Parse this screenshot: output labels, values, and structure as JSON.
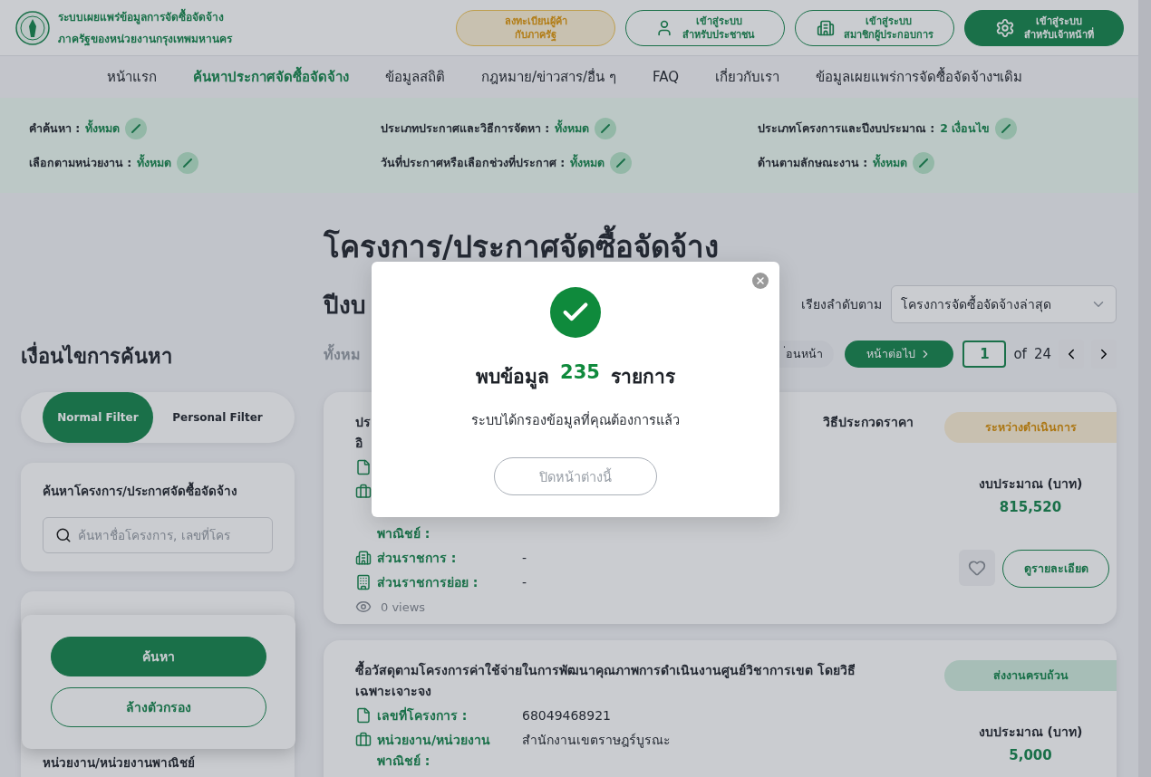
{
  "header": {
    "site_title": [
      "ระบบเผยแพร่ข้อมูลการจัดซื้อจัดจ้าง",
      "ภาครัฐของหน่วยงานกรุงเทพมหานคร"
    ],
    "buttons": [
      {
        "kind": "register",
        "lines": [
          "ลงทะเบียนผู้ค้า",
          "กับภาครัฐ"
        ]
      },
      {
        "kind": "citizen",
        "lines": [
          "เข้าสู่ระบบ",
          "สำหรับประชาชน"
        ]
      },
      {
        "kind": "member",
        "lines": [
          "เข้าสู่ระบบ",
          "สมาชิกผู้ประกอบการ"
        ]
      },
      {
        "kind": "staff",
        "lines": [
          "เข้าสู่ระบบ",
          "สำหรับเจ้าหน้าที่"
        ]
      }
    ]
  },
  "nav": [
    {
      "label": "หน้าแรก",
      "selected": false
    },
    {
      "label": "ค้นหาประกาศจัดซื้อจัดจ้าง",
      "selected": true
    },
    {
      "label": "ข้อมูลสถิติ",
      "selected": false
    },
    {
      "label": "กฎหมาย/ข่าวสาร/อื่น ๆ",
      "selected": false
    },
    {
      "label": "FAQ",
      "selected": false
    },
    {
      "label": "เกี่ยวกับเรา",
      "selected": false
    },
    {
      "label": "ข้อมูลเผยแพร่การจัดซื้อจัดจ้างฯเดิม",
      "selected": false
    }
  ],
  "filter_summary": [
    {
      "label": "คำค้นหา :",
      "value": "ทั้งหมด"
    },
    {
      "label": "ประเภทประกาศและวิธีการจัดหา :",
      "value": "ทั้งหมด"
    },
    {
      "label": "ประเภทโครงการและปีงบประมาณ :",
      "value": "2 เงื่อนไข"
    },
    {
      "label": "เลือกตามหน่วยงาน :",
      "value": "ทั้งหมด"
    },
    {
      "label": "วันที่ประกาศหรือเลือกช่วงที่ประกาศ :",
      "value": "ทั้งหมด"
    },
    {
      "label": "ด้านตามลักษณะงาน :",
      "value": "ทั้งหมด"
    }
  ],
  "sidebar": {
    "title": "เงื่อนไขการค้นหา",
    "filter_modes": [
      {
        "label": "Normal Filter",
        "selected": true
      },
      {
        "label": "Personal Filter",
        "selected": false
      }
    ],
    "search_card": {
      "title": "ค้นหาโครงการ/ประกาศจัดซื้อจัดจ้าง",
      "placeholder": "ค้นหาชื่อโครงการ, เลขที่โคร"
    },
    "unit_card_title": "หน่วยงาน/หน่วยงานพาณิชย์",
    "actions": [
      {
        "kind": "primary",
        "label": "ค้นหา"
      },
      {
        "kind": "outline",
        "label": "ล้างตัวกรอง"
      }
    ]
  },
  "main": {
    "title": "โครงการ/ประกาศจัดซื้อจัดจ้าง",
    "year_heading": "ปีงบ",
    "count_text": "ทั้งหม",
    "sort_label": "เรียงลำดับตาม",
    "sort_value": "โครงการจัดซื้อจัดจ้างล่าสุด",
    "pagination": {
      "prev": "่อนหน้า",
      "next": "หน้าต่อไป",
      "page": "1",
      "of": "of",
      "total": "24"
    },
    "cards": [
      {
        "title_lines": [
          {
            "left": "ปร",
            "right": "วิธีประกวดราคา"
          },
          {
            "left": "อิ"
          }
        ],
        "status": {
          "kind": "in_progress",
          "label": "ระหว่างดำเนินการ"
        },
        "fields": [
          {
            "kind": "document"
          },
          {
            "kind": "briefcase",
            "covered_top": true,
            "label_lines": [
              "พาณิชย์ :"
            ]
          },
          {
            "kind": "building",
            "label_lines": [
              "ส่วนราชการ :"
            ],
            "value": "-"
          },
          {
            "kind": "office",
            "label_lines": [
              "ส่วนราชการย่อย :"
            ],
            "value": "-"
          }
        ],
        "views": "0 views",
        "budget_label": "งบประมาณ (บาท)",
        "budget": "815,520",
        "details_button": "ดูรายละเอียด"
      },
      {
        "title_lines": [
          {
            "left": "ซื้อวัสดุตามโครงการค่าใช้จ่ายในการพัฒนาคุณภาพการดำเนินงานศูนย์วิชาการเขต โดยวิธี"
          },
          {
            "left": "เฉพาะเจาะจง"
          }
        ],
        "status": {
          "kind": "done",
          "label": "ส่งงานครบถ้วน"
        },
        "fields": [
          {
            "kind": "document",
            "label_lines": [
              "เลขที่โครงการ :"
            ],
            "value": "68049468921"
          },
          {
            "kind": "briefcase",
            "label_lines": [
              "หน่วยงาน/หน่วยงาน",
              "พาณิชย์ :"
            ],
            "value": "สำนักงานเขตราษฎร์บูรณะ"
          }
        ],
        "budget_label": "งบประมาณ (บาท)",
        "budget": "5,000"
      }
    ]
  },
  "modal": {
    "title_prefix": "พบข้อมูล",
    "count": "235",
    "title_suffix": "รายการ",
    "message": "ระบบได้กรองข้อมูลที่คุณต้องการแล้ว",
    "close_button": "ปิดหน้าต่างนี้"
  }
}
